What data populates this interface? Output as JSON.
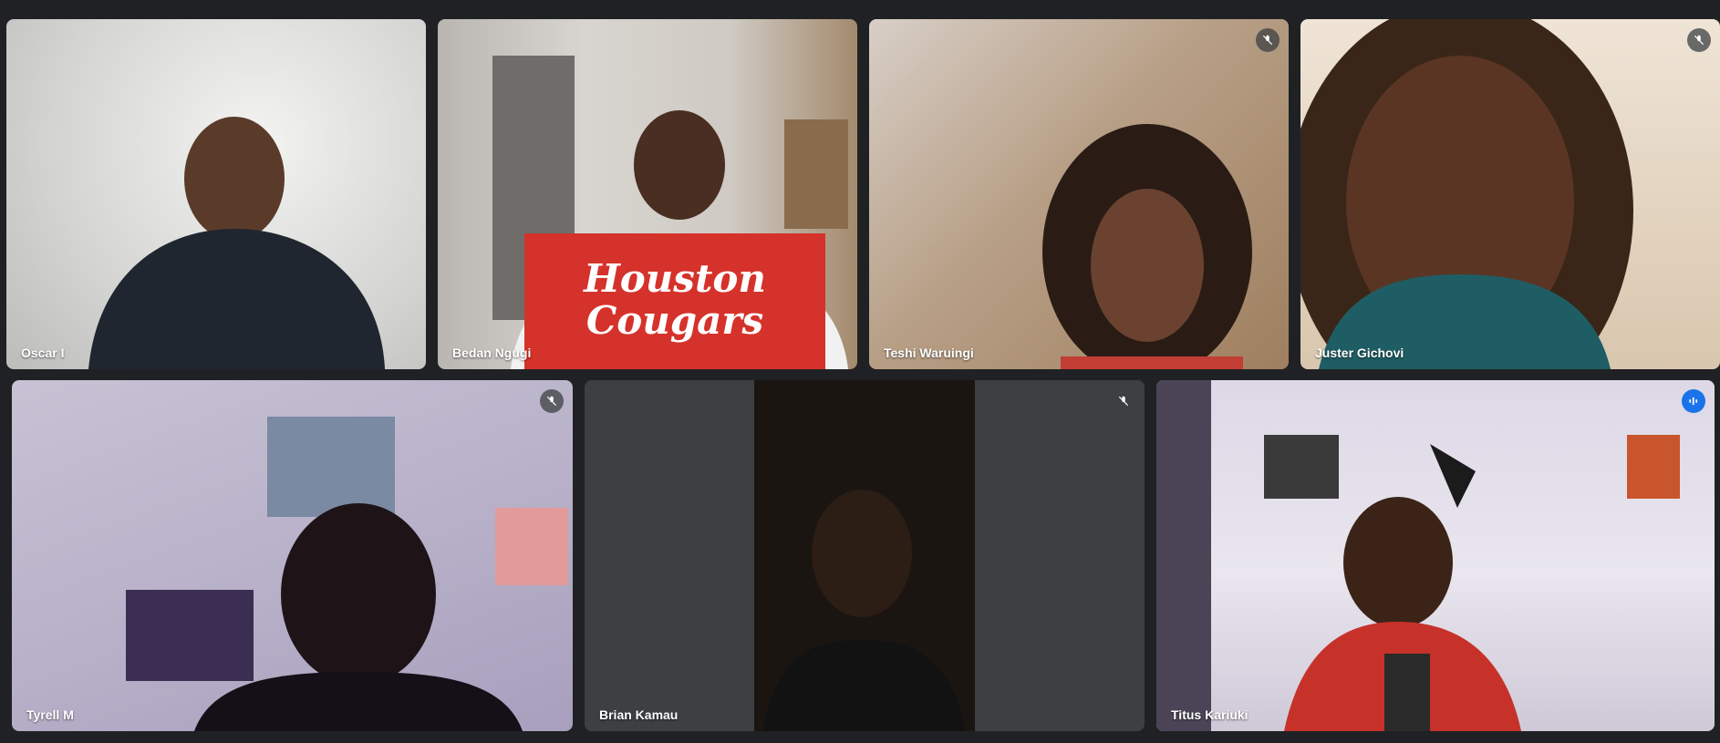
{
  "participants": [
    {
      "name": "Oscar I",
      "muted": false
    },
    {
      "name": "Bedan Ngugi",
      "muted": false,
      "banner": [
        "Houston",
        "Cougars"
      ]
    },
    {
      "name": "Teshi Waruingi",
      "muted": true
    },
    {
      "name": "Juster Gichovi",
      "muted": true
    },
    {
      "name": "Tyrell M",
      "muted": true
    },
    {
      "name": "Brian Kamau",
      "muted": true
    },
    {
      "name": "Titus Kariuki",
      "muted": false,
      "speaking": true
    }
  ],
  "icons": {
    "mute": "mic-off-icon",
    "speaking": "audio-level-icon"
  },
  "colors": {
    "background": "#202124",
    "tile": "#3c4043",
    "active_outline": "#8ab4f8",
    "speaking": "#1a73e8"
  }
}
